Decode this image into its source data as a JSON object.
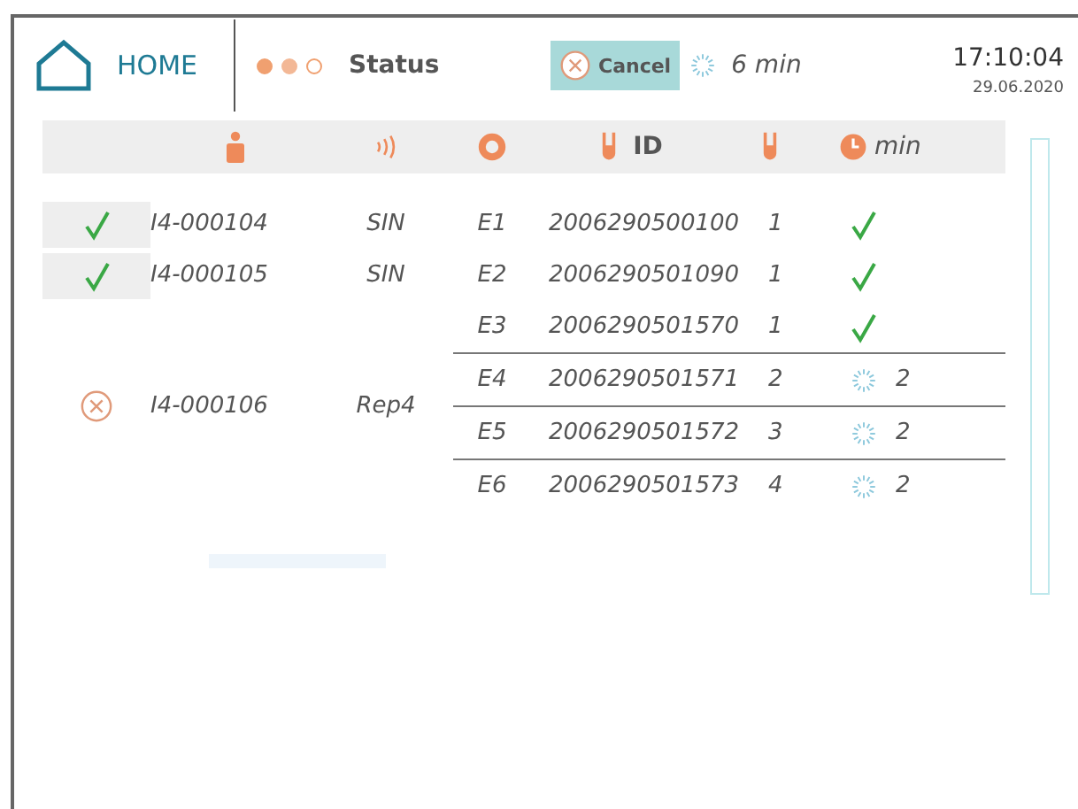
{
  "header": {
    "home_label": "HOME",
    "status_dots": [
      {
        "filled": true,
        "color": "#f0a070"
      },
      {
        "filled": true,
        "color": "#f3b896"
      },
      {
        "filled": false,
        "color": "#f0a070"
      }
    ],
    "status_label": "Status",
    "cancel_label": "Cancel",
    "remaining": "6 min",
    "time": "17:10:04",
    "date": "29.06.2020"
  },
  "table": {
    "id_label": "ID",
    "time_label": "min"
  },
  "samples": [
    {
      "kind": "done",
      "id": "I4-000104",
      "type": "SIN",
      "tubes": [
        {
          "position": "E1",
          "id": "2006290500100",
          "count": "1",
          "kind": "done"
        }
      ]
    },
    {
      "kind": "done",
      "id": "I4-000105",
      "type": "SIN",
      "tubes": [
        {
          "position": "E2",
          "id": "2006290501090",
          "count": "1",
          "kind": "done"
        }
      ]
    },
    {
      "kind": "cancelled",
      "id": "I4-000106",
      "type": "Rep4",
      "tubes": [
        {
          "position": "E3",
          "id": "2006290501570",
          "count": "1",
          "kind": "done"
        },
        {
          "position": "E4",
          "id": "2006290501571",
          "count": "2",
          "kind": "running",
          "minutes": "2"
        },
        {
          "position": "E5",
          "id": "2006290501572",
          "count": "3",
          "kind": "running",
          "minutes": "2"
        },
        {
          "position": "E6",
          "id": "2006290501573",
          "count": "4",
          "kind": "running",
          "minutes": "2"
        }
      ]
    }
  ]
}
